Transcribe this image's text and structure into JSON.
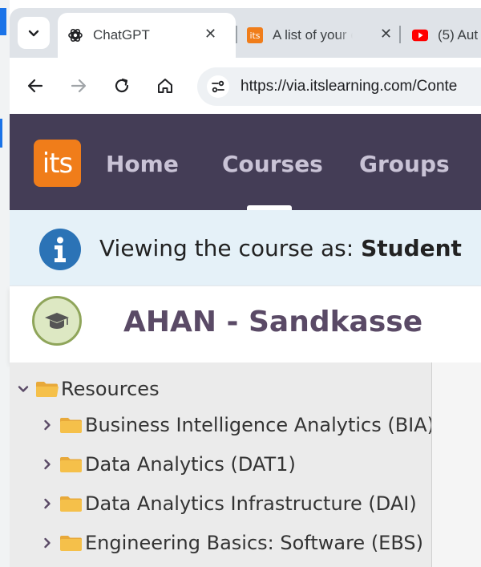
{
  "browser": {
    "tabs": [
      {
        "title": "ChatGPT",
        "favicon": "chatgpt-icon",
        "active": true
      },
      {
        "title": "A list of your co",
        "favicon": "itslearning-icon",
        "active": false
      },
      {
        "title": "(5) Aut",
        "favicon": "youtube-icon",
        "active": false
      }
    ],
    "itslearning_favicon_text": "its",
    "address": "https://via.itslearning.com/Conte"
  },
  "site": {
    "logo_text": "its",
    "nav": [
      {
        "label": "Home",
        "active": false
      },
      {
        "label": "Courses",
        "active": true
      },
      {
        "label": "Groups",
        "active": false
      }
    ]
  },
  "info": {
    "prefix": "Viewing the course as: ",
    "role": "Student"
  },
  "course": {
    "title": "AHAN - Sandkasse"
  },
  "resources": {
    "root_label": "Resources",
    "root_expanded": true,
    "items": [
      {
        "label": "Business Intelligence Analytics (BIA)"
      },
      {
        "label": "Data Analytics (DAT1)"
      },
      {
        "label": "Data Analytics Infrastructure (DAI)"
      },
      {
        "label": "Engineering Basics: Software (EBS)"
      }
    ]
  },
  "colors": {
    "nav_bg": "#443d56",
    "logo_bg": "#f07d1a",
    "info_bg": "#e5f1f8",
    "info_icon": "#2b73b6",
    "course_title": "#5a4a66",
    "folder": "#f5c04a"
  }
}
